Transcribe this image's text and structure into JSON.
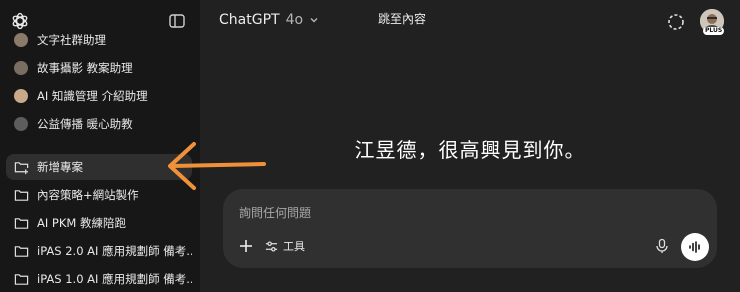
{
  "sidebar": {
    "items": [
      {
        "label": "文字社群助理",
        "icon": "avatar-icon"
      },
      {
        "label": "故事攝影 教案助理",
        "icon": "avatar-icon"
      },
      {
        "label": "AI 知識管理 介紹助理",
        "icon": "avatar-icon"
      },
      {
        "label": "公益傳播 暖心助教",
        "icon": "avatar-icon"
      },
      {
        "label": "新增專案",
        "icon": "new-folder-icon",
        "active": true
      },
      {
        "label": "內容策略+網站製作",
        "icon": "folder-icon"
      },
      {
        "label": "AI PKM 教練陪跑",
        "icon": "folder-icon"
      },
      {
        "label": "iPAS 2.0 AI 應用規劃師 備考...",
        "icon": "folder-icon"
      },
      {
        "label": "iPAS 1.0 AI 應用規劃師 備考...",
        "icon": "folder-icon"
      }
    ]
  },
  "header": {
    "model_name": "ChatGPT",
    "model_version": "4o",
    "skip_link": "跳至內容",
    "plus_badge": "PLUS"
  },
  "main": {
    "greeting": "江昱德，很高興見到你。",
    "composer": {
      "placeholder": "詢問任何問題",
      "tools_label": "工具"
    }
  },
  "colors": {
    "sidebar_bg": "#171717",
    "main_bg": "#212121",
    "composer_bg": "#303030",
    "annotation_arrow": "#f0913a"
  }
}
